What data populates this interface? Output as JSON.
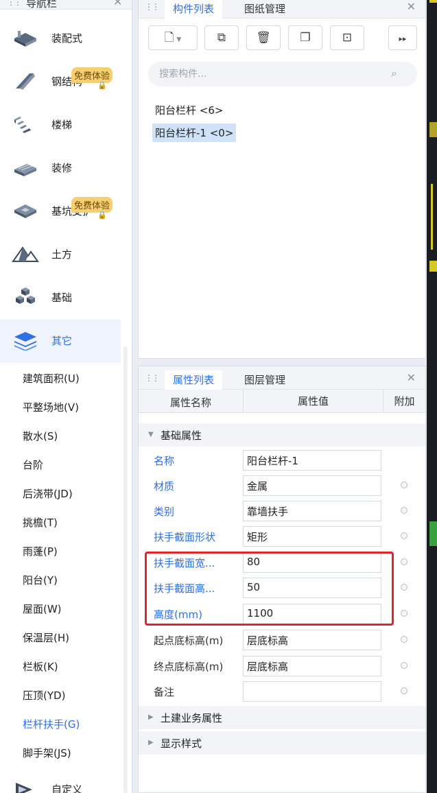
{
  "nav": {
    "title": "导航栏",
    "categories": [
      {
        "label": "装配式"
      },
      {
        "label": "钢结构",
        "badge": "免费体验"
      },
      {
        "label": "楼梯"
      },
      {
        "label": "装修"
      },
      {
        "label": "基坑支护",
        "badge": "免费体验"
      },
      {
        "label": "土方"
      },
      {
        "label": "基础"
      },
      {
        "label": "其它"
      },
      {
        "label": "自定义"
      }
    ],
    "subitems": [
      "建筑面积(U)",
      "平整场地(V)",
      "散水(S)",
      "台阶",
      "后浇带(JD)",
      "挑檐(T)",
      "雨蓬(P)",
      "阳台(Y)",
      "屋面(W)",
      "保温层(H)",
      "栏板(K)",
      "压顶(YD)",
      "栏杆扶手(G)",
      "脚手架(JS)"
    ]
  },
  "component_panel": {
    "tabs": [
      "构件列表",
      "图纸管理"
    ],
    "search_placeholder": "搜索构件...",
    "items": [
      "阳台栏杆 <6>",
      "阳台栏杆-1 <0>"
    ]
  },
  "property_panel": {
    "tabs": [
      "属性列表",
      "图层管理"
    ],
    "columns": [
      "属性名称",
      "属性值",
      "附加"
    ],
    "groups": {
      "basic": "基础属性",
      "civil": "土建业务属性",
      "display": "显示样式"
    },
    "rows": [
      {
        "name": "名称",
        "value": "阳台栏杆-1"
      },
      {
        "name": "材质",
        "value": "金属"
      },
      {
        "name": "类别",
        "value": "靠墙扶手"
      },
      {
        "name": "扶手截面形状",
        "value": "矩形"
      },
      {
        "name": "扶手截面宽...",
        "value": "80"
      },
      {
        "name": "扶手截面高...",
        "value": "50"
      },
      {
        "name": "高度(mm)",
        "value": "1100"
      },
      {
        "name": "起点底标高(m)",
        "value": "层底标高"
      },
      {
        "name": "终点底标高(m)",
        "value": "层底标高"
      },
      {
        "name": "备注",
        "value": ""
      }
    ]
  },
  "colors": {
    "accent": "#2f6fe4",
    "highlight": "#e0242b",
    "badge": "#f6cf72"
  }
}
